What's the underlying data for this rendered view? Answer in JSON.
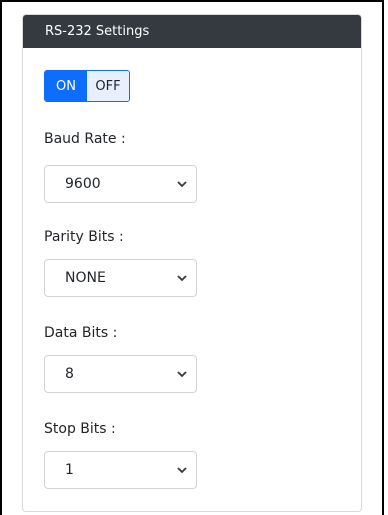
{
  "panel": {
    "title": "RS-232 Settings"
  },
  "toggle": {
    "on_label": "ON",
    "off_label": "OFF",
    "active": "ON"
  },
  "fields": [
    {
      "label": "Baud Rate :",
      "value": "9600"
    },
    {
      "label": "Parity Bits :",
      "value": "NONE"
    },
    {
      "label": "Data Bits :",
      "value": "8"
    },
    {
      "label": "Stop Bits :",
      "value": "1"
    }
  ],
  "colors": {
    "header_bg": "#343a40",
    "accent": "#0d6efd"
  },
  "icons": {
    "dropdown": "chevron-down-icon"
  }
}
